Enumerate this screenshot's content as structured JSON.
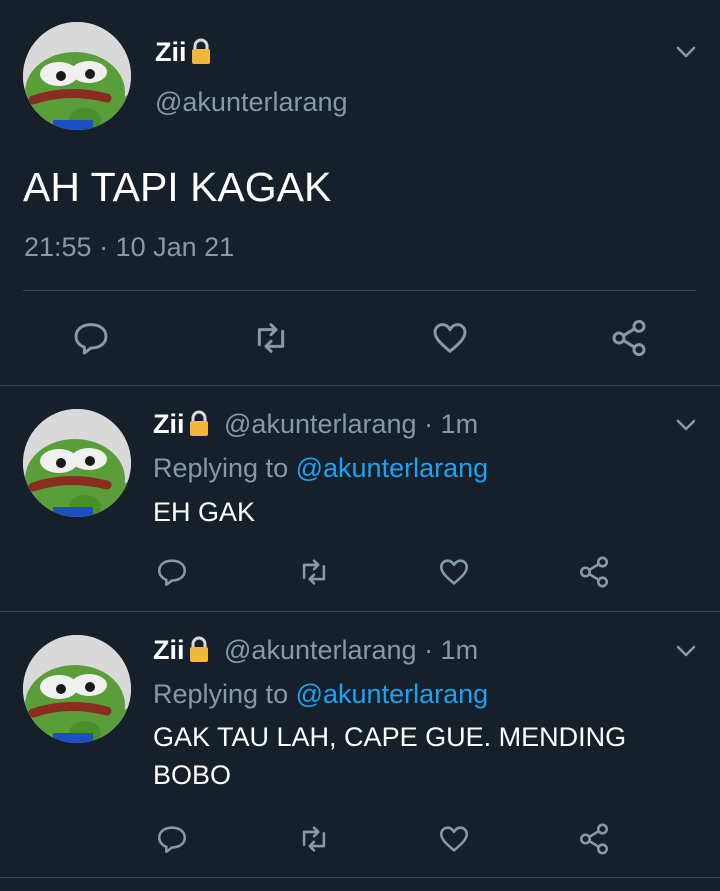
{
  "main_tweet": {
    "display_name": "Zii",
    "handle": "@akunterlarang",
    "text": "AH TAPI KAGAK",
    "timestamp": "21:55 · 10 Jan 21"
  },
  "replies": [
    {
      "display_name": "Zii",
      "handle": "@akunterlarang",
      "time": "· 1m",
      "replying_prefix": "Replying to",
      "replying_to": "@akunterlarang",
      "text": "EH GAK"
    },
    {
      "display_name": "Zii",
      "handle": "@akunterlarang",
      "time": "· 1m",
      "replying_prefix": "Replying to",
      "replying_to": "@akunterlarang",
      "text_line1": "GAK TAU LAH, CAPE GUE. MENDING",
      "text_line2": "BOBO"
    }
  ],
  "icons": [
    "chevron-down-icon",
    "lock-icon",
    "reply-icon",
    "retweet-icon",
    "like-icon",
    "share-icon"
  ],
  "colors": {
    "background": "#15202b",
    "text": "#ffffff",
    "muted": "#8899a6",
    "link": "#1da1f2",
    "divider": "#38444d"
  }
}
